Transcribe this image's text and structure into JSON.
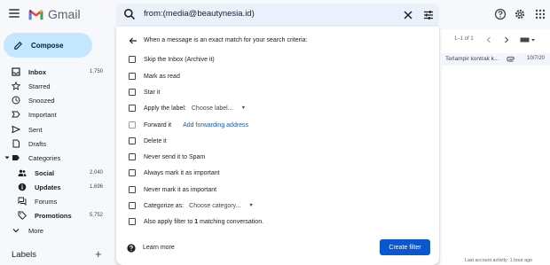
{
  "app": {
    "name": "Gmail"
  },
  "search": {
    "query": "from:(media@beautynesia.id)"
  },
  "compose": {
    "label": "Compose"
  },
  "sidebar": {
    "items": [
      {
        "label": "Inbox",
        "count": "1,750",
        "icon": "inbox-icon"
      },
      {
        "label": "Starred",
        "count": "",
        "icon": "star-icon"
      },
      {
        "label": "Snoozed",
        "count": "",
        "icon": "clock-icon"
      },
      {
        "label": "Important",
        "count": "",
        "icon": "important-icon"
      },
      {
        "label": "Sent",
        "count": "",
        "icon": "send-icon"
      },
      {
        "label": "Drafts",
        "count": "",
        "icon": "draft-icon"
      },
      {
        "label": "Categories",
        "count": "",
        "icon": "label-icon"
      },
      {
        "label": "Social",
        "count": "2,040",
        "icon": "people-icon"
      },
      {
        "label": "Updates",
        "count": "1,696",
        "icon": "info-icon"
      },
      {
        "label": "Forums",
        "count": "",
        "icon": "forum-icon"
      },
      {
        "label": "Promotions",
        "count": "5,752",
        "icon": "tag-icon"
      },
      {
        "label": "More",
        "count": "",
        "icon": "chevron-down-icon"
      }
    ],
    "labels_heading": "Labels"
  },
  "filter": {
    "heading": "When a message is an exact match for your search criteria:",
    "options": {
      "skip_inbox": "Skip the Inbox (Archive it)",
      "mark_read": "Mark as read",
      "star_it": "Star it",
      "apply_label": "Apply the label:",
      "apply_label_choose": "Choose label...",
      "forward": "Forward it",
      "add_forwarding": "Add forwarding address",
      "delete": "Delete it",
      "never_spam": "Never send it to Spam",
      "always_important": "Always mark it as important",
      "never_important": "Never mark it as important",
      "categorize": "Categorize as:",
      "categorize_choose": "Choose category...",
      "also_apply_pre": "Also apply filter to ",
      "also_apply_count": "1",
      "also_apply_post": " matching conversation."
    },
    "learn_more": "Learn more",
    "create_button": "Create filter"
  },
  "list": {
    "pager": "1–1 of 1",
    "snippet": "Terlampir kontrak k...",
    "date": "10/7/20",
    "last_activity": "Last account activity: 1 hour ago"
  },
  "colors": {
    "accent": "#0b57d0",
    "compose_bg": "#c2e7ff",
    "search_bg": "#eaf1fb"
  }
}
